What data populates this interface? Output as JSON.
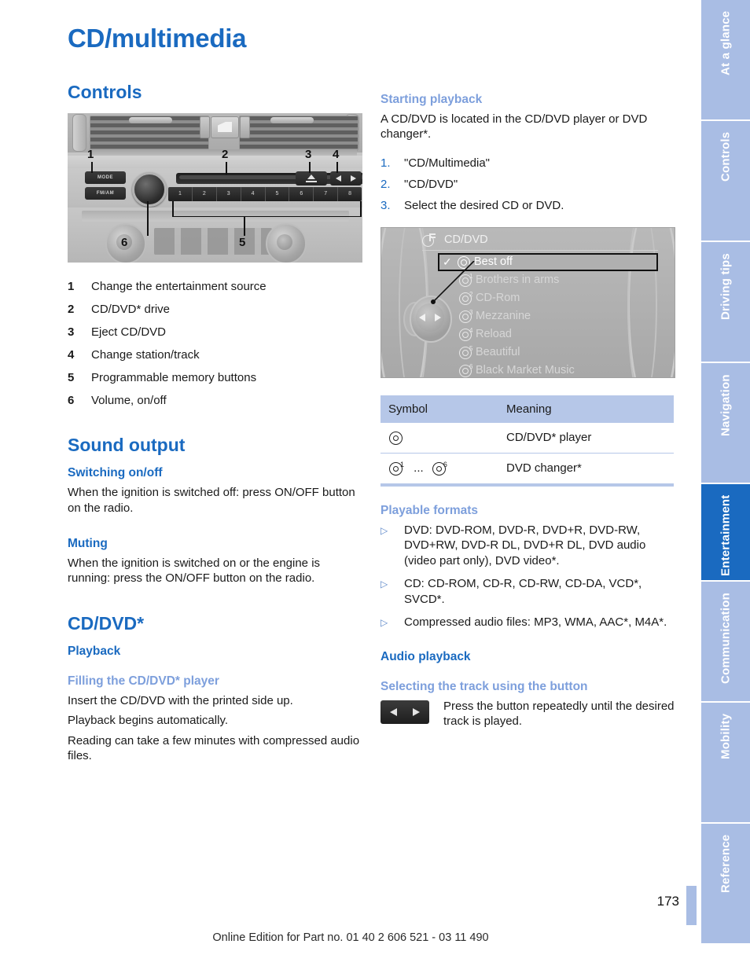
{
  "page": {
    "title": "CD/multimedia",
    "number": "173",
    "footer": "Online Edition for Part no. 01 40 2 606 521 - 03 11 490"
  },
  "left": {
    "controls_heading": "Controls",
    "legend": [
      {
        "num": "1",
        "text": "Change the entertainment source"
      },
      {
        "num": "2",
        "text": "CD/DVD* drive"
      },
      {
        "num": "3",
        "text": "Eject CD/DVD"
      },
      {
        "num": "4",
        "text": "Change station/track"
      },
      {
        "num": "5",
        "text": "Programmable memory buttons"
      },
      {
        "num": "6",
        "text": "Volume, on/off"
      }
    ],
    "radio_image": {
      "mode_button": "MODE",
      "fm_am_button": "FM/AM",
      "presets": [
        "1",
        "2",
        "3",
        "4",
        "5",
        "6",
        "7",
        "8"
      ],
      "callouts": [
        "1",
        "2",
        "3",
        "4",
        "5",
        "6"
      ]
    },
    "sound_output_heading": "Sound output",
    "switching_heading": "Switching on/off",
    "switching_body": "When the ignition is switched off: press ON/OFF button on the radio.",
    "muting_heading": "Muting",
    "muting_body": "When the ignition is switched on or the engine is running: press the ON/OFF button on the radio.",
    "cddvd_heading": "CD/DVD*",
    "playback_heading": "Playback",
    "filling_heading": "Filling the CD/DVD* player",
    "filling_body_1": "Insert the CD/DVD with the printed side up.",
    "filling_body_2": "Playback begins automatically.",
    "filling_body_3": "Reading can take a few minutes with compressed audio files."
  },
  "right": {
    "starting_heading": "Starting playback",
    "starting_body": "A CD/DVD is located in the CD/DVD player or DVD changer*.",
    "steps": [
      {
        "num": "1.",
        "text": "\"CD/Multimedia\""
      },
      {
        "num": "2.",
        "text": "\"CD/DVD\""
      },
      {
        "num": "3.",
        "text": "Select the desired CD or DVD."
      }
    ],
    "idrive": {
      "header": "CD/DVD",
      "items": [
        {
          "name": "Best off",
          "selected": true,
          "sup": ""
        },
        {
          "name": "Brothers in arms",
          "selected": false,
          "sup": "1"
        },
        {
          "name": "CD-Rom",
          "selected": false,
          "sup": "2"
        },
        {
          "name": "Mezzanine",
          "selected": false,
          "sup": "3"
        },
        {
          "name": "Reload",
          "selected": false,
          "sup": "4"
        },
        {
          "name": "Beautiful",
          "selected": false,
          "sup": "5"
        },
        {
          "name": "Black Market Music",
          "selected": false,
          "sup": "6"
        }
      ],
      "check_glyph": "✓"
    },
    "table": {
      "col_symbol": "Symbol",
      "col_meaning": "Meaning",
      "rows": [
        {
          "symbol_sup": "",
          "symbol_range": "",
          "meaning": "CD/DVD* player"
        },
        {
          "symbol_sup": "1",
          "symbol_range": "...",
          "symbol_sup2": "6",
          "meaning": "DVD changer*"
        }
      ]
    },
    "formats_heading": "Playable formats",
    "formats": [
      "DVD: DVD-ROM, DVD-R, DVD+R, DVD-RW, DVD+RW, DVD-R DL, DVD+R DL, DVD audio (video part only), DVD video*.",
      "CD: CD-ROM, CD-R, CD-RW, CD-DA, VCD*, SVCD*.",
      "Compressed audio files: MP3, WMA, AAC*, M4A*."
    ],
    "bullet_glyph": "▷",
    "audio_heading": "Audio playback",
    "selecting_heading": "Selecting the track using the button",
    "selecting_body": "Press the button repeatedly until the desired track is played."
  },
  "sidebar": {
    "tabs": [
      {
        "label": "At a glance",
        "active": false
      },
      {
        "label": "Controls",
        "active": false
      },
      {
        "label": "Driving tips",
        "active": false
      },
      {
        "label": "Navigation",
        "active": false
      },
      {
        "label": "Entertainment",
        "active": true
      },
      {
        "label": "Communication",
        "active": false
      },
      {
        "label": "Mobility",
        "active": false
      },
      {
        "label": "Reference",
        "active": false
      }
    ]
  },
  "colors": {
    "accent_blue": "#1a6ac0",
    "light_blue": "#7d9fdc",
    "tab_blue": "#a9bde4",
    "table_header": "#b6c7e8"
  }
}
